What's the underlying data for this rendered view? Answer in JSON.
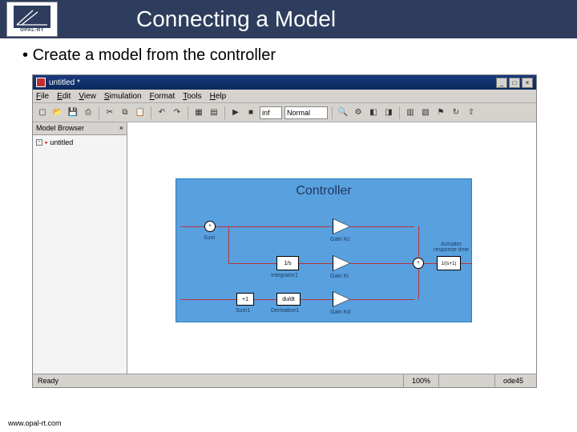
{
  "slide": {
    "title": "Connecting a Model",
    "bullet": "Create a model from the controller",
    "footer": "www.opal-rt.com",
    "logo_text": "OPAL-RT"
  },
  "window": {
    "title": "untitled *",
    "menu": {
      "file": "File",
      "edit": "Edit",
      "view": "View",
      "simulation": "Simulation",
      "format": "Format",
      "tools": "Tools",
      "help": "Help"
    },
    "toolbar": {
      "sim_mode": "Normal",
      "time_field": "inf"
    },
    "sidebar": {
      "title": "Model Browser",
      "close": "×",
      "root": "untitled"
    },
    "status": {
      "left": "Ready",
      "zoom": "100%",
      "solver": "ode45"
    }
  },
  "controller": {
    "title": "Controller",
    "labels": {
      "sum": "Sum",
      "gain_kc": "Gain Kc",
      "integrator": "Integrator1",
      "gain_ki": "Gain Ki",
      "sum1": "Sum1",
      "derivative": "Derivative1",
      "gain_kd": "Gain Kd",
      "actuator": "Actuator response time",
      "int_text": "1/s",
      "sum1_text": "+1",
      "deriv_text": "du/dt",
      "act_text": "1/(s+1)"
    }
  }
}
